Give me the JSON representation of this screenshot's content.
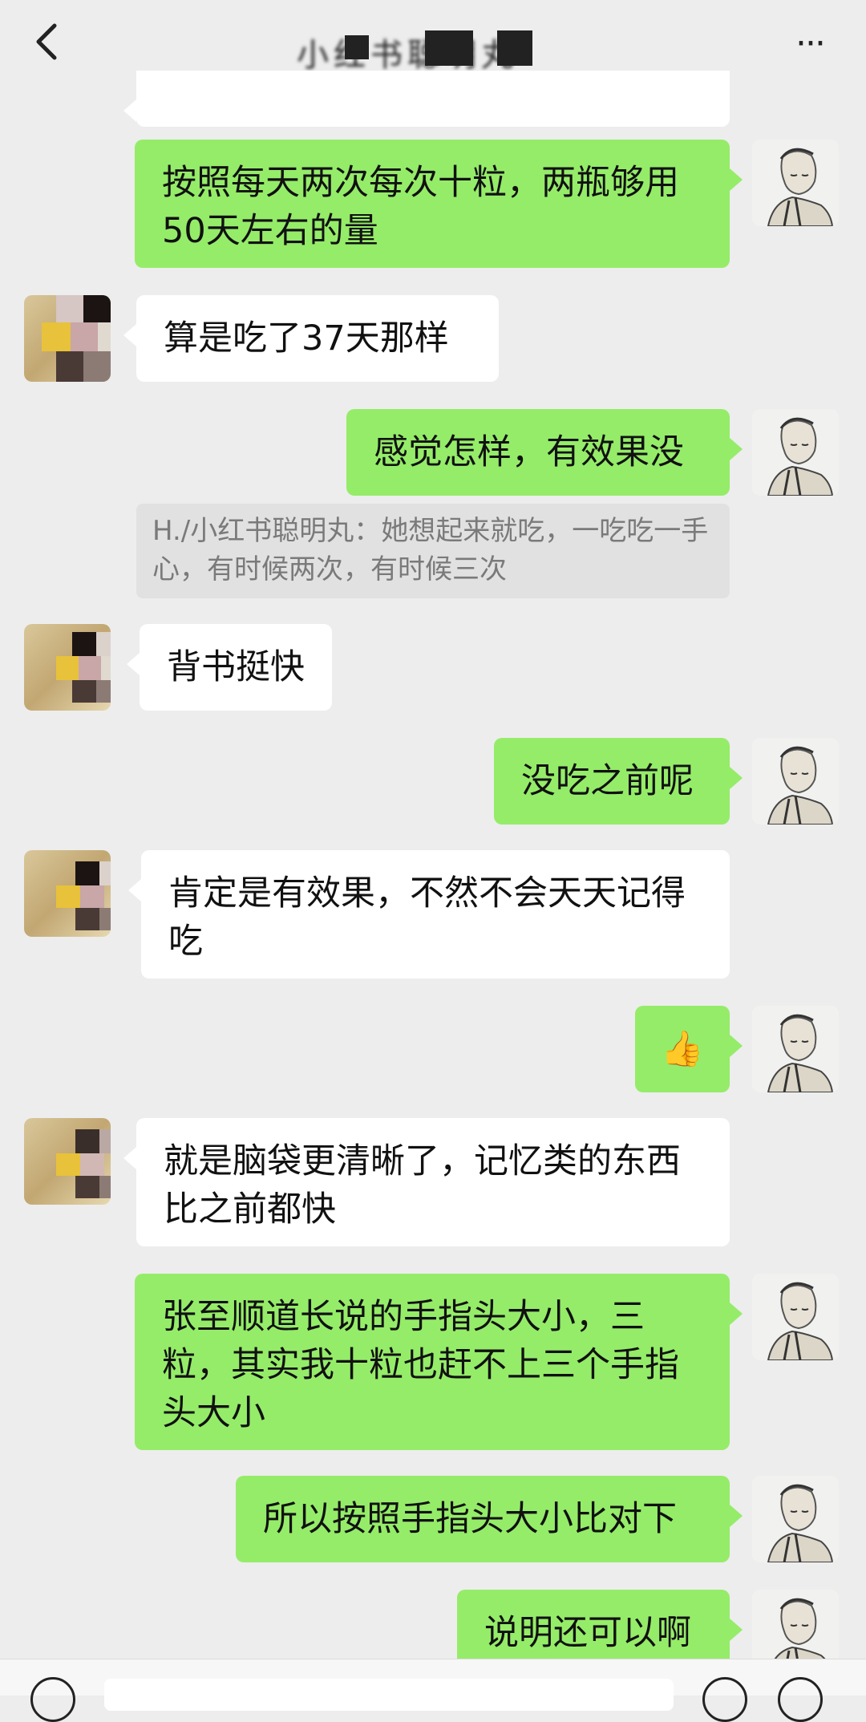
{
  "header": {
    "back_icon": "chevron-left-icon",
    "title": "小红书聪明丸",
    "more_label": "···"
  },
  "messages": [
    {
      "side": "me",
      "text": "按照每天两次每次十粒，两瓶够用50天左右的量"
    },
    {
      "side": "other",
      "text": "算是吃了37天那样"
    },
    {
      "side": "me",
      "text": "感觉怎样，有效果没"
    },
    {
      "side": "quote",
      "text": "H./小红书聪明丸：她想起来就吃，一吃吃一手心，有时候两次，有时候三次"
    },
    {
      "side": "other",
      "text": "背书挺快"
    },
    {
      "side": "me",
      "text": "没吃之前呢"
    },
    {
      "side": "other",
      "text": "肯定是有效果，不然不会天天记得吃"
    },
    {
      "side": "me",
      "text": "👍",
      "icon": "thumbs-up-icon"
    },
    {
      "side": "other",
      "text": "就是脑袋更清晰了，记忆类的东西比之前都快"
    },
    {
      "side": "me",
      "text": "张至顺道长说的手指头大小，三粒，其实我十粒也赶不上三个手指头大小"
    },
    {
      "side": "me",
      "text": "所以按照手指头大小比对下"
    },
    {
      "side": "me",
      "text": "说明还可以啊"
    }
  ],
  "colors": {
    "background": "#ededed",
    "my_bubble": "#95ec69",
    "other_bubble": "#ffffff",
    "quote_bg": "#e1e1e1",
    "quote_text": "#7a7a7a"
  }
}
